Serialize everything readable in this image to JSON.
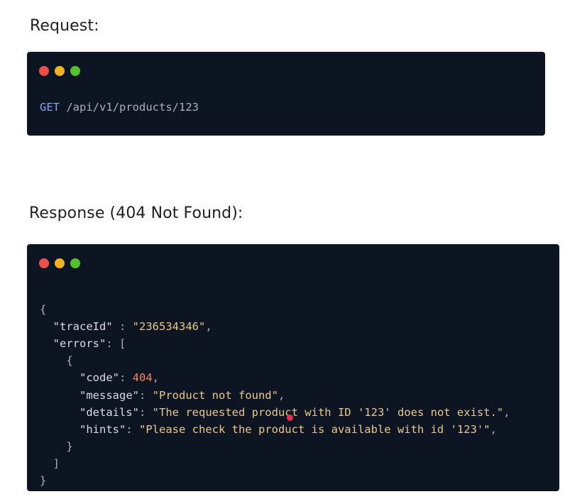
{
  "request": {
    "heading": "Request:",
    "method": "GET",
    "path": "/api/v1/products/123"
  },
  "response": {
    "heading": "Response (404 Not Found):",
    "trace_key": "\"traceId\"",
    "trace_value": "\"236534346\"",
    "errors_key": "\"errors\"",
    "code_key": "\"code\"",
    "code_value": "404",
    "message_key": "\"message\"",
    "message_value": "\"Product not found\"",
    "details_key": "\"details\"",
    "details_value": "\"The requested product with ID '123' does not exist.\"",
    "hints_key": "\"hints\"",
    "hints_value": "\"Please check the product is available with id '123'\""
  },
  "colors": {
    "window_background": "#0d1523",
    "dot_red": "#ea4f4a",
    "dot_yellow": "#f0b323",
    "dot_green": "#52c22f",
    "method": "#8aa4f5",
    "string": "#e8c98a",
    "number": "#ef8a5f",
    "cursor": "#e0304c"
  },
  "icons": [
    "close-dot-icon",
    "minimize-dot-icon",
    "maximize-dot-icon",
    "pointer-dot-icon"
  ]
}
